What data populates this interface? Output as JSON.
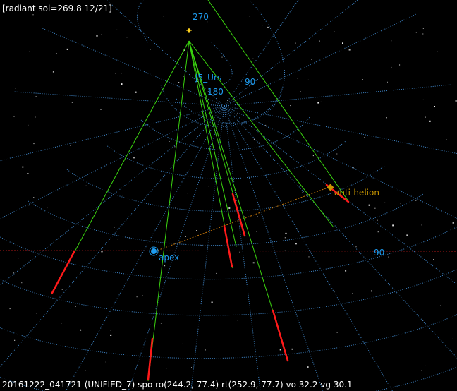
{
  "header": {
    "text": "[radiant sol=269.8 12/21]"
  },
  "footer": {
    "text": "20161222_041721 (UNIFIED_7) spo ro(244.2, 77.4) rt(252.9, 77.7) vo 32.2 vg 30.1"
  },
  "grid_labels": {
    "a270": "270",
    "a90_top": "90",
    "a180": "180",
    "a90_right": "90"
  },
  "points": {
    "radiant_name": "J5_Urs",
    "anti_helion": "anti-helion",
    "apex": "apex"
  },
  "colors": {
    "background": "#000000",
    "grid": "#3f86c9",
    "grid_label": "#1e9cf0",
    "trail": "#3bd60f",
    "meteor": "#ff1a1a",
    "ecliptic": "#c8780a",
    "horizon": "#b01818",
    "radiant_marker": "#ffd21e",
    "anti_helion_label": "#c89600",
    "apex_label": "#1e9cf0",
    "text": "#ffffff"
  }
}
